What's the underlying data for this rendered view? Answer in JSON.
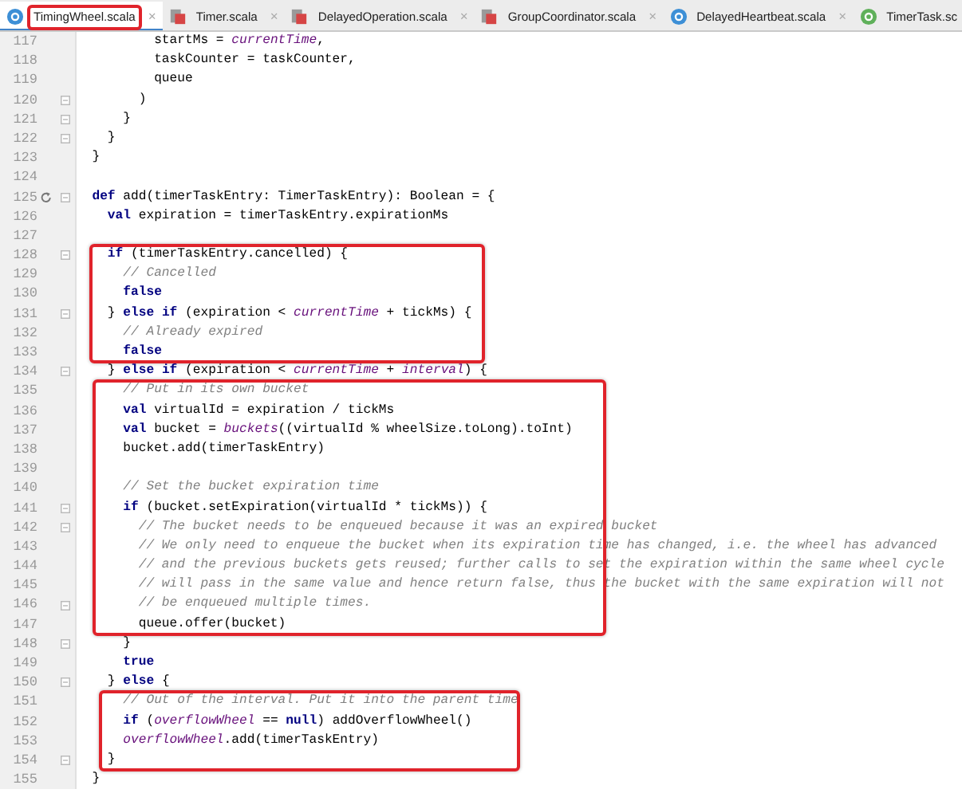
{
  "tabs": [
    {
      "label": "TimingWheel.scala",
      "kind": "class",
      "selected": true,
      "boxed": true,
      "close": "×"
    },
    {
      "label": "Timer.scala",
      "kind": "object",
      "selected": false,
      "close": "×"
    },
    {
      "label": "DelayedOperation.scala",
      "kind": "object",
      "selected": false,
      "close": "×"
    },
    {
      "label": "GroupCoordinator.scala",
      "kind": "object",
      "selected": false,
      "close": "×"
    },
    {
      "label": "DelayedHeartbeat.scala",
      "kind": "class",
      "selected": false,
      "close": "×"
    },
    {
      "label": "TimerTask.sc",
      "kind": "trait",
      "selected": false
    }
  ],
  "blocks": [
    {
      "lines": [
        {
          "number": "117",
          "tokens": [
            {
              "kind": "plain",
              "text": "          startMs = "
            },
            {
              "kind": "field",
              "text": "currentTime"
            },
            {
              "kind": "plain",
              "text": ","
            }
          ]
        },
        {
          "number": "118",
          "tokens": [
            {
              "kind": "plain",
              "text": "          taskCounter = taskCounter,"
            }
          ]
        },
        {
          "number": "119",
          "tokens": [
            {
              "kind": "plain",
              "text": "          queue"
            }
          ]
        },
        {
          "number": "120",
          "fold": true,
          "tokens": [
            {
              "kind": "plain",
              "text": "        )"
            }
          ]
        },
        {
          "number": "121",
          "fold": true,
          "tokens": [
            {
              "kind": "plain",
              "text": "      }"
            }
          ]
        },
        {
          "number": "122",
          "fold": true,
          "tokens": [
            {
              "kind": "plain",
              "text": "    }"
            }
          ]
        },
        {
          "number": "123",
          "tokens": [
            {
              "kind": "plain",
              "text": "  }"
            }
          ]
        },
        {
          "number": "124"
        },
        {
          "number": "125",
          "fold": true,
          "override": true,
          "tokens": [
            {
              "kind": "keyword",
              "text": "  def"
            },
            {
              "kind": "plain",
              "text": " add(timerTaskEntry: TimerTaskEntry): Boolean = {"
            }
          ]
        },
        {
          "number": "126",
          "tokens": [
            {
              "kind": "keyword",
              "text": "    val"
            },
            {
              "kind": "plain",
              "text": " expiration = timerTaskEntry.expirationMs"
            }
          ]
        },
        {
          "number": "127"
        }
      ]
    },
    {
      "boxed": true,
      "lines": [
        {
          "number": "128",
          "fold": true,
          "tokens": [
            {
              "kind": "keyword",
              "text": "    if"
            },
            {
              "kind": "plain",
              "text": " (timerTaskEntry.cancelled) {"
            }
          ]
        },
        {
          "number": "129",
          "tokens": [
            {
              "kind": "comment",
              "text": "      // Cancelled"
            }
          ]
        },
        {
          "number": "130",
          "tokens": [
            {
              "kind": "keyword",
              "text": "      false"
            }
          ]
        },
        {
          "number": "131",
          "fold": true,
          "tokens": [
            {
              "kind": "plain",
              "text": "    } "
            },
            {
              "kind": "keyword",
              "text": "else if"
            },
            {
              "kind": "plain",
              "text": " (expiration < "
            },
            {
              "kind": "field",
              "text": "currentTime"
            },
            {
              "kind": "plain",
              "text": " + tickMs) {"
            }
          ]
        },
        {
          "number": "132",
          "tokens": [
            {
              "kind": "comment",
              "text": "      // Already expired"
            }
          ]
        },
        {
          "number": "133",
          "tokens": [
            {
              "kind": "keyword",
              "text": "      false"
            }
          ]
        }
      ]
    },
    {
      "lines": [
        {
          "number": "134",
          "fold": true,
          "tokens": [
            {
              "kind": "plain",
              "text": "    } "
            },
            {
              "kind": "keyword",
              "text": "else if"
            },
            {
              "kind": "plain",
              "text": " (expiration < "
            },
            {
              "kind": "field",
              "text": "currentTime"
            },
            {
              "kind": "plain",
              "text": " + "
            },
            {
              "kind": "field",
              "text": "interval"
            },
            {
              "kind": "plain",
              "text": ") {"
            }
          ]
        }
      ]
    },
    {
      "boxed": true,
      "lines": [
        {
          "number": "135",
          "tokens": [
            {
              "kind": "comment",
              "text": "      // Put in its own bucket"
            }
          ]
        },
        {
          "number": "136",
          "tokens": [
            {
              "kind": "keyword",
              "text": "      val"
            },
            {
              "kind": "plain",
              "text": " virtualId = expiration / tickMs"
            }
          ]
        },
        {
          "number": "137",
          "tokens": [
            {
              "kind": "keyword",
              "text": "      val"
            },
            {
              "kind": "plain",
              "text": " bucket = "
            },
            {
              "kind": "field",
              "text": "buckets"
            },
            {
              "kind": "plain",
              "text": "((virtualId % wheelSize.toLong).toInt)"
            }
          ]
        },
        {
          "number": "138",
          "tokens": [
            {
              "kind": "plain",
              "text": "      bucket.add(timerTaskEntry)"
            }
          ]
        },
        {
          "number": "139"
        },
        {
          "number": "140",
          "tokens": [
            {
              "kind": "comment",
              "text": "      // Set the bucket expiration time"
            }
          ]
        },
        {
          "number": "141",
          "fold": true,
          "tokens": [
            {
              "kind": "keyword",
              "text": "      if"
            },
            {
              "kind": "plain",
              "text": " (bucket.setExpiration(virtualId * tickMs)) {"
            }
          ]
        },
        {
          "number": "142",
          "fold": true,
          "tokens": [
            {
              "kind": "comment",
              "text": "        // The bucket needs to be enqueued because it was an expired bucket"
            }
          ]
        },
        {
          "number": "143",
          "tokens": [
            {
              "kind": "comment",
              "text": "        // We only need to enqueue the bucket when its expiration time has changed, i.e. the wheel has advanced"
            }
          ]
        },
        {
          "number": "144",
          "tokens": [
            {
              "kind": "comment",
              "text": "        // and the previous buckets gets reused; further calls to set the expiration within the same wheel cycle"
            }
          ]
        },
        {
          "number": "145",
          "tokens": [
            {
              "kind": "comment",
              "text": "        // will pass in the same value and hence return false, thus the bucket with the same expiration will not"
            }
          ]
        },
        {
          "number": "146",
          "fold": true,
          "tokens": [
            {
              "kind": "comment",
              "text": "        // be enqueued multiple times."
            }
          ]
        },
        {
          "number": "147",
          "tokens": [
            {
              "kind": "plain",
              "text": "        queue.offer(bucket)"
            }
          ]
        }
      ]
    },
    {
      "lines": [
        {
          "number": "148",
          "fold": true,
          "tokens": [
            {
              "kind": "plain",
              "text": "      }"
            }
          ]
        },
        {
          "number": "149",
          "tokens": [
            {
              "kind": "keyword",
              "text": "      true"
            }
          ]
        },
        {
          "number": "150",
          "fold": true,
          "tokens": [
            {
              "kind": "plain",
              "text": "    } "
            },
            {
              "kind": "keyword",
              "text": "else"
            },
            {
              "kind": "plain",
              "text": " {"
            }
          ]
        }
      ]
    },
    {
      "boxed": true,
      "lines": [
        {
          "number": "151",
          "tokens": [
            {
              "kind": "comment",
              "text": "      // Out of the interval. Put it into the parent time"
            }
          ]
        },
        {
          "number": "152",
          "tokens": [
            {
              "kind": "keyword",
              "text": "      if"
            },
            {
              "kind": "plain",
              "text": " ("
            },
            {
              "kind": "field",
              "text": "overflowWheel"
            },
            {
              "kind": "plain",
              "text": " == "
            },
            {
              "kind": "keyword",
              "text": "null"
            },
            {
              "kind": "plain",
              "text": ") addOverflowWheel()"
            }
          ]
        },
        {
          "number": "153",
          "tokens": [
            {
              "kind": "field",
              "text": "      overflowWheel"
            },
            {
              "kind": "plain",
              "text": ".add(timerTaskEntry)"
            }
          ]
        },
        {
          "number": "154",
          "fold": true,
          "tokens": [
            {
              "kind": "plain",
              "text": "    }"
            }
          ]
        }
      ]
    },
    {
      "lines": [
        {
          "number": "155",
          "tokens": [
            {
              "kind": "plain",
              "text": "  }"
            }
          ]
        }
      ]
    }
  ]
}
